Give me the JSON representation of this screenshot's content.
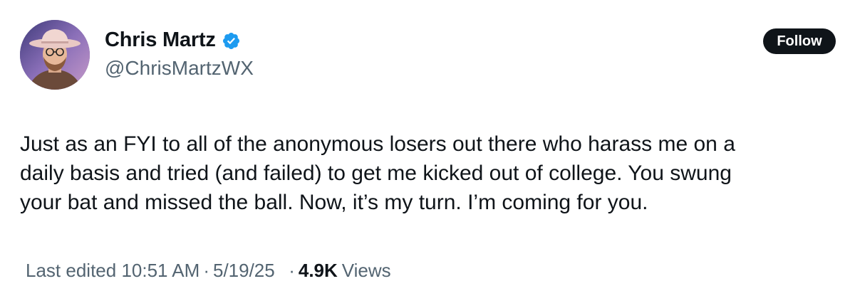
{
  "author": {
    "display_name": "Chris Martz",
    "handle": "@ChrisMartzWX",
    "verified": true,
    "avatar_icon": "profile-photo-cowboy-hat"
  },
  "actions": {
    "follow_label": "Follow"
  },
  "post": {
    "text": "Just as an FYI to all of the anonymous losers out there who harass me on a\ndaily basis and tried (and failed) to get me kicked out of college. You swung\nyour bat and missed the ball. Now, it’s my turn. I’m coming for you."
  },
  "meta": {
    "edited_prefix": "Last edited",
    "time": "10:51 AM",
    "separator": "·",
    "date": "5/19/25",
    "views_count": "4.9K",
    "views_label": "Views"
  },
  "colors": {
    "text_primary": "#0f1419",
    "text_secondary": "#536471",
    "verified_blue": "#1d9bf0",
    "button_bg": "#0f1419"
  }
}
